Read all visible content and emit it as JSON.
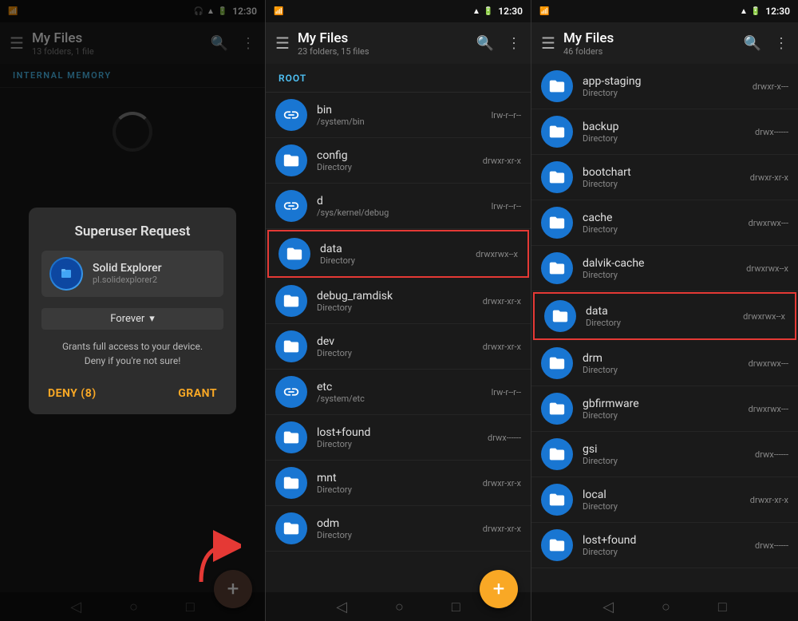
{
  "colors": {
    "accent": "#4fc3f7",
    "background": "#1a1a1a",
    "surface": "#2d2d2d",
    "deny": "#f9a825",
    "grant": "#f9a825",
    "highlight": "#e53935",
    "fab_dark": "#5d4037",
    "fab_yellow": "#f9a825",
    "folder_blue": "#1976d2"
  },
  "panel1": {
    "status": {
      "time": "12:30",
      "left_icon": "📶"
    },
    "topbar": {
      "title": "My Files",
      "subtitle": "13 folders, 1 file"
    },
    "breadcrumb": "INTERNAL MEMORY",
    "dialog": {
      "title": "Superuser Request",
      "app_name": "Solid Explorer",
      "app_pkg": "pl.solidexplorer2",
      "dropdown_label": "Forever",
      "warning_line1": "Grants full access to your device.",
      "warning_line2": "Deny if you're not sure!",
      "deny_label": "DENY (8)",
      "grant_label": "GRANT"
    },
    "fab_label": "+"
  },
  "panel2": {
    "status": {
      "time": "12:30"
    },
    "topbar": {
      "title": "My Files",
      "subtitle": "23 folders, 15 files"
    },
    "breadcrumb": "ROOT",
    "files": [
      {
        "name": "bin",
        "sub": "/system/bin",
        "perm": "lrw-r--r--",
        "type": "link"
      },
      {
        "name": "config",
        "sub": "Directory",
        "perm": "drwxr-xr-x",
        "type": "folder"
      },
      {
        "name": "d",
        "sub": "/sys/kernel/debug",
        "perm": "lrw-r--r--",
        "type": "link"
      },
      {
        "name": "data",
        "sub": "Directory",
        "perm": "drwxrwx--x",
        "type": "folder",
        "highlighted": true
      },
      {
        "name": "debug_ramdisk",
        "sub": "Directory",
        "perm": "drwxr-xr-x",
        "type": "folder"
      },
      {
        "name": "dev",
        "sub": "Directory",
        "perm": "drwxr-xr-x",
        "type": "folder"
      },
      {
        "name": "etc",
        "sub": "/system/etc",
        "perm": "lrw-r--r--",
        "type": "link"
      },
      {
        "name": "lost+found",
        "sub": "Directory",
        "perm": "drwx------",
        "type": "folder"
      },
      {
        "name": "mnt",
        "sub": "Directory",
        "perm": "drwxr-xr-x",
        "type": "folder"
      },
      {
        "name": "odm",
        "sub": "Directory",
        "perm": "drwxr-xr-x",
        "type": "folder"
      }
    ],
    "fab_label": "+"
  },
  "panel3": {
    "status": {
      "time": "12:30"
    },
    "topbar": {
      "title": "My Files",
      "subtitle": "46 folders"
    },
    "files": [
      {
        "name": "app-staging",
        "sub": "Directory",
        "perm": "drwxr-x---",
        "type": "folder"
      },
      {
        "name": "backup",
        "sub": "Directory",
        "perm": "drwx------",
        "type": "folder",
        "annotation": "backup Directory"
      },
      {
        "name": "bootchart",
        "sub": "Directory",
        "perm": "drwxr-xr-x",
        "type": "folder"
      },
      {
        "name": "cache",
        "sub": "Directory",
        "perm": "drwxrwx---",
        "type": "folder"
      },
      {
        "name": "dalvik-cache",
        "sub": "Directory",
        "perm": "drwxrwx--x",
        "type": "folder"
      },
      {
        "name": "data",
        "sub": "Directory",
        "perm": "drwxrwx--x",
        "type": "folder",
        "highlighted": true
      },
      {
        "name": "drm",
        "sub": "Directory",
        "perm": "drwxrwx---",
        "type": "folder"
      },
      {
        "name": "gbfirmware",
        "sub": "Directory",
        "perm": "drwxrwx---",
        "type": "folder"
      },
      {
        "name": "gsi",
        "sub": "Directory",
        "perm": "drwx------",
        "type": "folder"
      },
      {
        "name": "local",
        "sub": "Directory",
        "perm": "drwxr-xr-x",
        "type": "folder",
        "annotation": "local Directory"
      },
      {
        "name": "lost+found",
        "sub": "Directory",
        "perm": "drwx------",
        "type": "folder"
      }
    ]
  }
}
